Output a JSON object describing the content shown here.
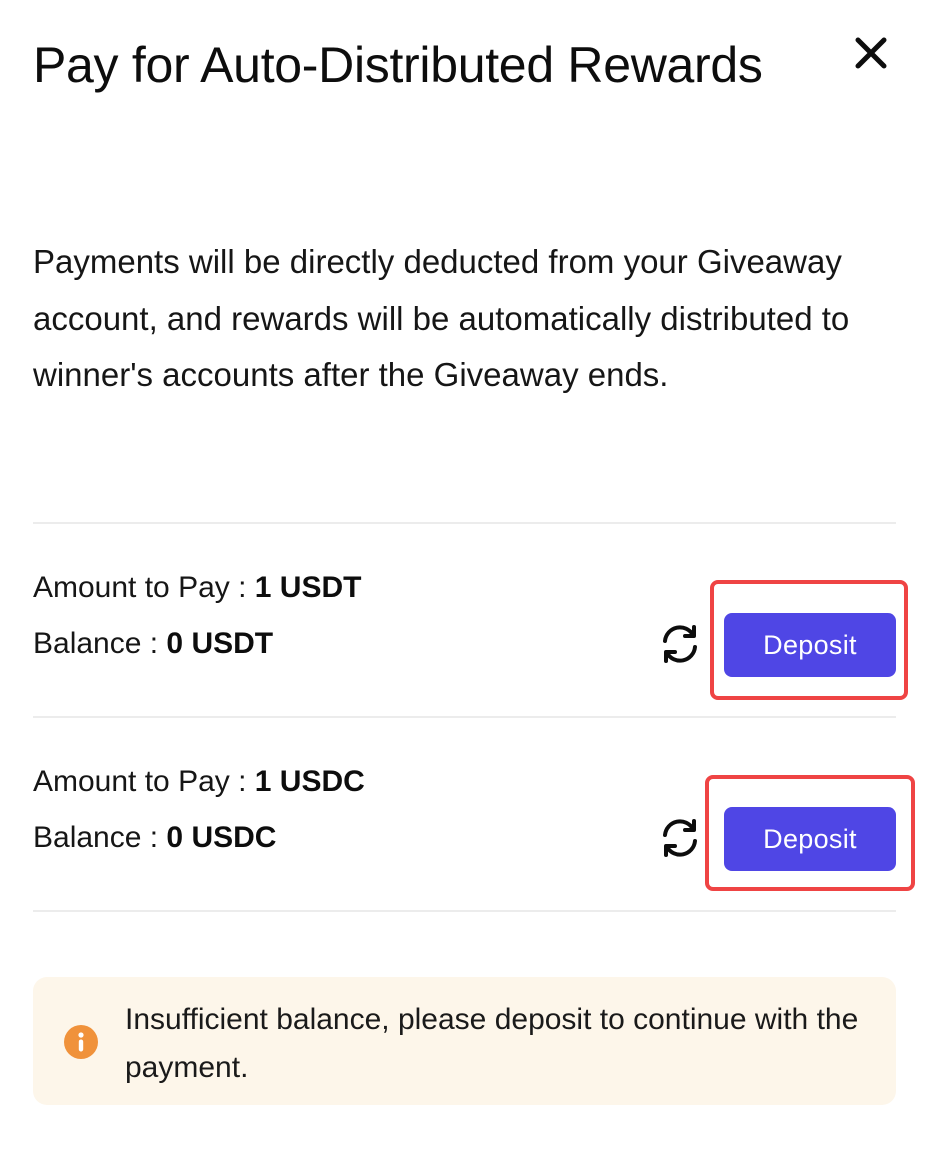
{
  "dialog": {
    "title": "Pay for Auto-Distributed Rewards",
    "description": "Payments will be directly deducted from your Giveaway account, and rewards will be automatically distributed to winner's accounts after the Giveaway ends.",
    "close_icon": "close-icon"
  },
  "payments": [
    {
      "amount_label": "Amount to Pay : ",
      "amount_value": "1 USDT",
      "balance_label": "Balance : ",
      "balance_value": "0 USDT",
      "refresh_icon": "refresh-icon",
      "deposit_label": "Deposit"
    },
    {
      "amount_label": "Amount to Pay : ",
      "amount_value": "1 USDC",
      "balance_label": "Balance : ",
      "balance_value": "0 USDC",
      "refresh_icon": "refresh-icon",
      "deposit_label": "Deposit"
    }
  ],
  "notice": {
    "icon": "info-icon",
    "message": "Insufficient balance, please deposit to continue with the payment."
  },
  "colors": {
    "accent": "#4f46e5",
    "highlight": "#ef4444",
    "notice_bg": "#fdf6ea",
    "info_icon": "#f0923b"
  }
}
